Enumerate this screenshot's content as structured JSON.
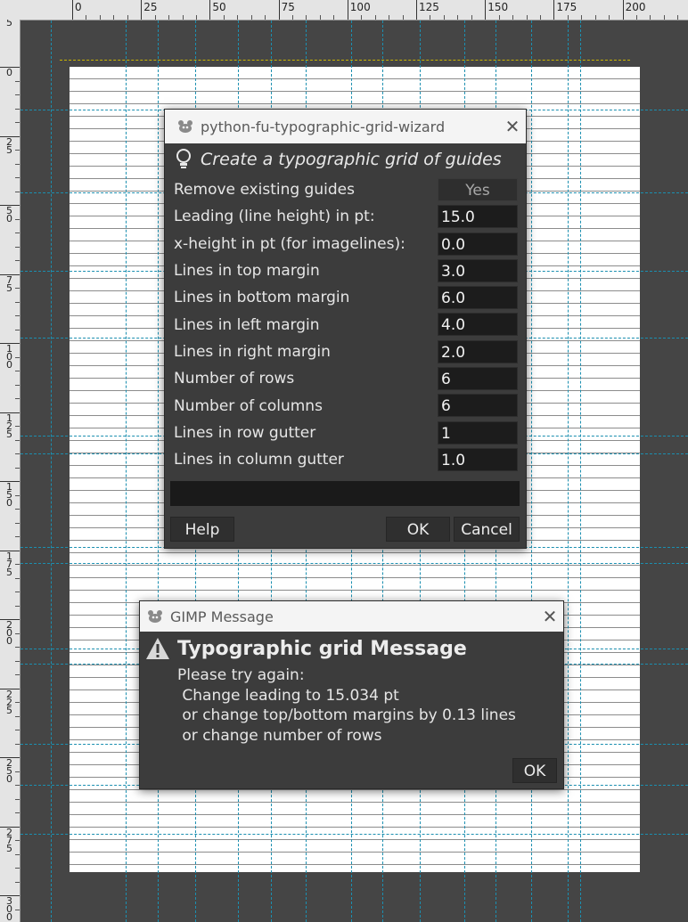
{
  "rulers": {
    "top_labels": [
      "0",
      "25",
      "50",
      "75",
      "100",
      "125",
      "150",
      "175",
      "200"
    ],
    "left_labels": [
      "5",
      "0",
      "25",
      "50",
      "75",
      "100",
      "125",
      "150",
      "175",
      "200",
      "225",
      "250",
      "275",
      "300"
    ]
  },
  "wizard": {
    "title": "python-fu-typographic-grid-wizard",
    "header": "Create a typographic grid of guides",
    "fields": [
      {
        "label": "Remove existing guides",
        "value": "Yes"
      },
      {
        "label": "Leading (line height) in pt:",
        "value": "15.0"
      },
      {
        "label": "x-height in pt (for imagelines):",
        "value": "0.0"
      },
      {
        "label": "Lines in top margin",
        "value": "3.0"
      },
      {
        "label": "Lines in bottom margin",
        "value": "6.0"
      },
      {
        "label": "Lines in left margin",
        "value": "4.0"
      },
      {
        "label": "Lines in right margin",
        "value": "2.0"
      },
      {
        "label": "Number of rows",
        "value": "6"
      },
      {
        "label": "Number of columns",
        "value": "6"
      },
      {
        "label": "Lines in row gutter",
        "value": "1"
      },
      {
        "label": "Lines in column gutter",
        "value": "1.0"
      }
    ],
    "buttons": {
      "help": "Help",
      "ok": "OK",
      "cancel": "Cancel"
    }
  },
  "message": {
    "title": "GIMP Message",
    "heading": "Typographic grid Message",
    "line1": "Please try again:",
    "line2": " Change leading to 15.034 pt",
    "line3": " or change top/bottom margins by 0.13 lines",
    "line4": " or change number of rows",
    "ok": "OK"
  },
  "colors": {
    "guide": "#1b8fb0",
    "dialog_bg": "#3c3c3c",
    "titlebar_bg": "#f4f4f4"
  }
}
